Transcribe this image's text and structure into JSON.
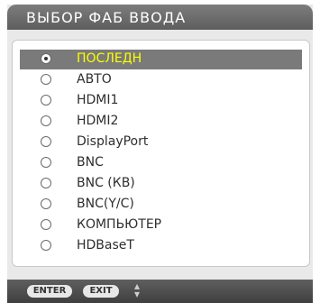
{
  "dialog": {
    "title": "ВЫБОР ФАБ ВВОДА"
  },
  "options": [
    {
      "label": "ПОСЛЕДН",
      "selected": true
    },
    {
      "label": "АВТО",
      "selected": false
    },
    {
      "label": "HDMI1",
      "selected": false
    },
    {
      "label": "HDMI2",
      "selected": false
    },
    {
      "label": "DisplayPort",
      "selected": false
    },
    {
      "label": "BNC",
      "selected": false
    },
    {
      "label": "BNC (КВ)",
      "selected": false
    },
    {
      "label": "BNC(Y/C)",
      "selected": false
    },
    {
      "label": "КОМПЬЮТЕР",
      "selected": false
    },
    {
      "label": "HDBaseT",
      "selected": false
    }
  ],
  "footer": {
    "enter_label": "ENTER",
    "exit_label": "EXIT",
    "nav_icon": "up-down-arrows-icon"
  },
  "colors": {
    "selected_text": "#ffff00",
    "selected_bg": "#7a7a7a",
    "title_bar": "#6a6a6a"
  }
}
